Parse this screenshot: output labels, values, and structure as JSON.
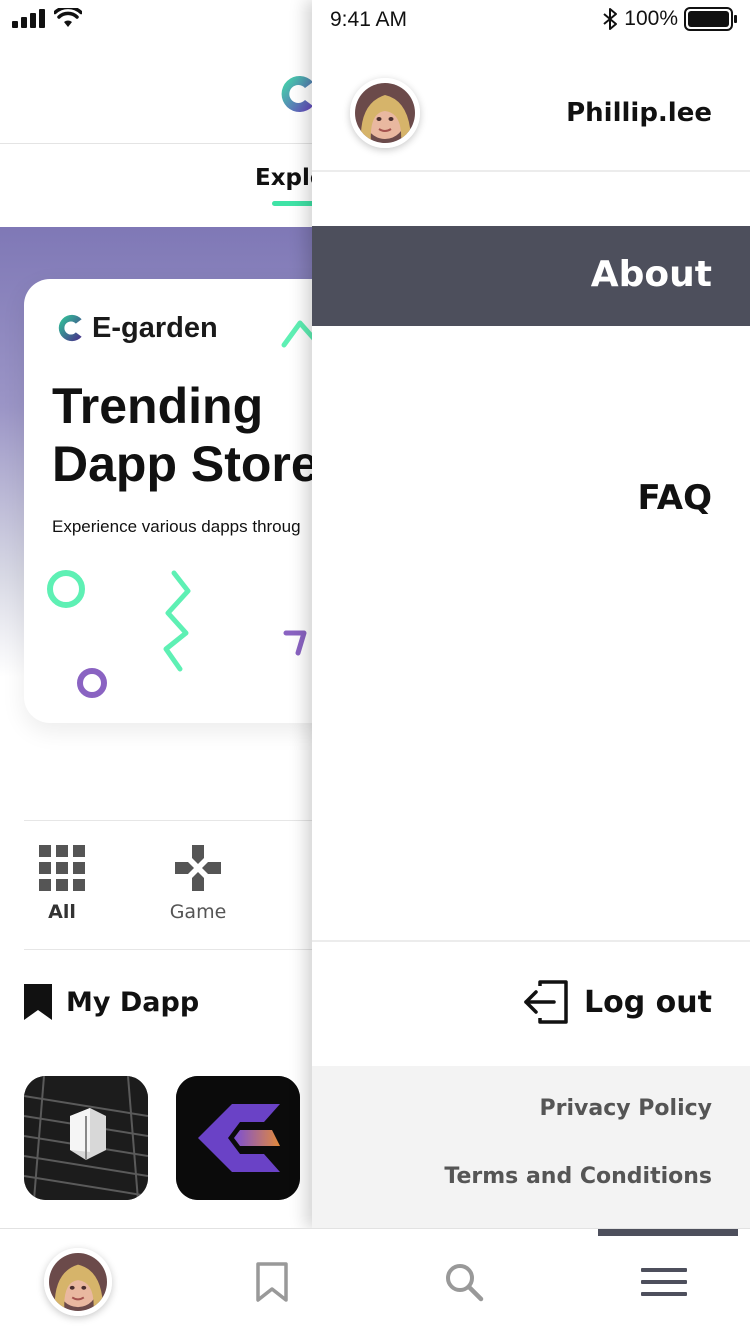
{
  "status_bar": {
    "time": "9:41 AM",
    "battery": "100%",
    "icons": [
      "signal-icon",
      "wifi-icon",
      "bluetooth-icon",
      "battery-icon"
    ]
  },
  "app": {
    "tabs": [
      {
        "label": "Explo",
        "active": true
      }
    ],
    "hero": {
      "brand": "E-garden",
      "title_line1": "Trending",
      "title_line2": "Dapp Store",
      "description": "Experience various dapps throug"
    },
    "categories": [
      {
        "label": "All",
        "icon": "grid-icon"
      },
      {
        "label": "Game",
        "icon": "gamepad-icon"
      }
    ],
    "my_dapp": {
      "title": "My Dapp",
      "icon": "bookmark-icon"
    }
  },
  "drawer": {
    "username": "Phillip.lee",
    "menu": [
      {
        "label": "About",
        "active": true
      },
      {
        "label": "FAQ",
        "active": false
      }
    ],
    "logout_label": "Log out",
    "footer_links": [
      "Privacy Policy",
      "Terms and Conditions"
    ]
  },
  "bottom_nav": {
    "items": [
      {
        "name": "profile",
        "icon": "avatar"
      },
      {
        "name": "bookmarks",
        "icon": "bookmark-outline-icon"
      },
      {
        "name": "search",
        "icon": "search-icon"
      },
      {
        "name": "menu",
        "icon": "hamburger-menu-icon",
        "active": true
      }
    ]
  },
  "colors": {
    "accent": "#3fe3a6",
    "drawer_active": "#4d4f5c",
    "purple": "#8a63c2",
    "hero_gradient_top": "#7f78b6"
  }
}
